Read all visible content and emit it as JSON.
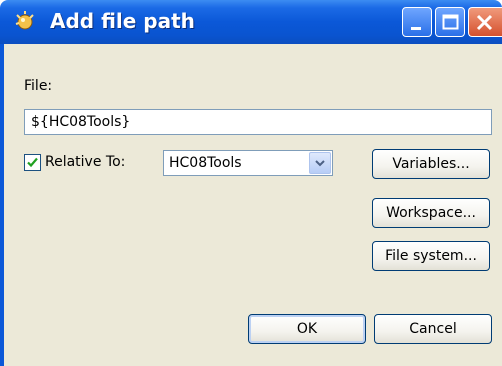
{
  "window": {
    "title": "Add file path",
    "controls": {
      "minimize": "minimize",
      "maximize": "maximize",
      "close": "close"
    }
  },
  "form": {
    "file_label": "File:",
    "file_value": "${HC08Tools}",
    "relative_checked": true,
    "relative_label": "Relative To:",
    "relative_value": "HC08Tools"
  },
  "buttons": {
    "variables": "Variables...",
    "workspace": "Workspace...",
    "file_system": "File system...",
    "ok": "OK",
    "cancel": "Cancel"
  },
  "colors": {
    "titlebar": "#0b58d8",
    "dialog_bg": "#ece9d8",
    "check_mark": "#21a121"
  }
}
